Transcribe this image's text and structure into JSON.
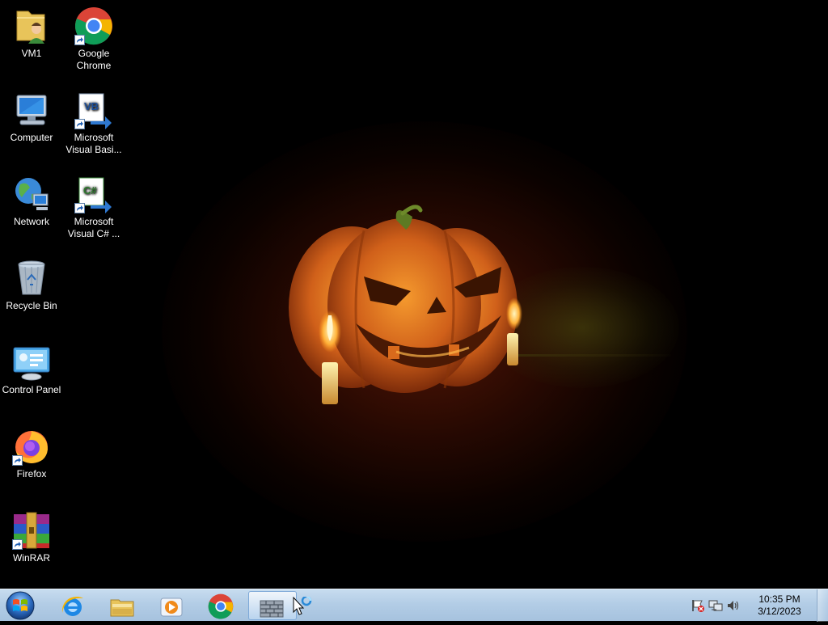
{
  "desktop": {
    "icons": [
      {
        "label": "VM1",
        "icon": "user-folder-icon"
      },
      {
        "label": "Google Chrome",
        "icon": "chrome-icon"
      },
      {
        "label": "Computer",
        "icon": "computer-icon"
      },
      {
        "label": "Microsoft Visual Basi...",
        "icon": "visual-basic-icon"
      },
      {
        "label": "Network",
        "icon": "network-icon"
      },
      {
        "label": "Microsoft Visual C# ...",
        "icon": "visual-csharp-icon"
      },
      {
        "label": "Recycle Bin",
        "icon": "recycle-bin-icon"
      },
      {
        "label": "Control Panel",
        "icon": "control-panel-icon"
      },
      {
        "label": "Firefox",
        "icon": "firefox-icon"
      },
      {
        "label": "WinRAR",
        "icon": "winrar-icon"
      }
    ],
    "wallpaper": "halloween-pumpkin-wallpaper",
    "icon_glyphs": {
      "vb": "VB",
      "csharp": "C#"
    }
  },
  "taskbar": {
    "start_icon": "windows-start-orb-icon",
    "pinned": [
      {
        "name": "Internet Explorer",
        "icon": "internet-explorer-icon"
      },
      {
        "name": "Windows Explorer",
        "icon": "file-explorer-icon"
      },
      {
        "name": "Windows Media Player",
        "icon": "media-player-icon"
      },
      {
        "name": "Google Chrome",
        "icon": "chrome-icon"
      },
      {
        "name": "Active window",
        "icon": "firewall-wall-icon",
        "active": true
      }
    ],
    "tray": {
      "icons": [
        "action-center-flag-icon",
        "network-status-icon",
        "volume-icon"
      ],
      "time": "10:35 PM",
      "date": "3/12/2023"
    }
  },
  "colors": {
    "taskbar": "#b3cde6",
    "wallpaper_bg": "#000000",
    "pumpkin": "#e0701a"
  }
}
